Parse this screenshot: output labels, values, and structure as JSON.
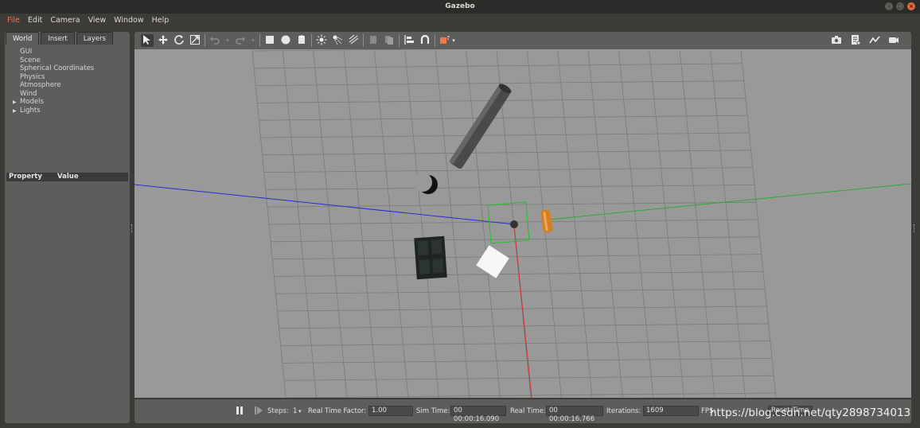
{
  "window": {
    "title": "Gazebo",
    "controls": [
      "–",
      "□",
      "×"
    ]
  },
  "menu": [
    {
      "label": "File",
      "active": true
    },
    {
      "label": "Edit"
    },
    {
      "label": "Camera"
    },
    {
      "label": "View"
    },
    {
      "label": "Window"
    },
    {
      "label": "Help"
    }
  ],
  "left_panel": {
    "tabs": [
      "World",
      "Insert",
      "Layers"
    ],
    "active_tab": "World",
    "tree": [
      {
        "label": "GUI",
        "expandable": false
      },
      {
        "label": "Scene",
        "expandable": false
      },
      {
        "label": "Spherical Coordinates",
        "expandable": false
      },
      {
        "label": "Physics",
        "expandable": false
      },
      {
        "label": "Atmosphere",
        "expandable": false
      },
      {
        "label": "Wind",
        "expandable": false
      },
      {
        "label": "Models",
        "expandable": true
      },
      {
        "label": "Lights",
        "expandable": true
      }
    ],
    "property_header": {
      "property": "Property",
      "value": "Value"
    }
  },
  "toolbar": {
    "icons": [
      "select-arrow-icon",
      "translate-icon",
      "rotate-icon",
      "scale-icon",
      "undo-icon",
      "redo-icon",
      "box-icon",
      "sphere-icon",
      "cylinder-icon",
      "point-light-icon",
      "spot-light-icon",
      "directional-light-icon",
      "copy-icon",
      "paste-icon",
      "align-icon",
      "snap-icon",
      "view-angle-icon"
    ],
    "right_icons": [
      "screenshot-icon",
      "log-icon",
      "plot-icon",
      "video-record-icon"
    ]
  },
  "bottom_bar": {
    "steps_label": "Steps:",
    "steps_value": "1",
    "rtf_label": "Real Time Factor:",
    "rtf_value": "1.00",
    "sim_time_label": "Sim Time:",
    "sim_time_value": "00 00:00:16.090",
    "real_time_label": "Real Time:",
    "real_time_value": "00 00:00:16.766",
    "iterations_label": "Iterations:",
    "iterations_value": "1609",
    "fps_label": "FPS:",
    "reset_label": "Reset Time"
  },
  "watermark": "https://blog.csdn.net/qty2898734013",
  "colors": {
    "accent": "#f07746",
    "viewport_bg": "#999999",
    "panel_bg": "#5d5d5b",
    "x_axis": "#d03030",
    "y_axis": "#2fa82f",
    "z_axis": "#2a2ad0"
  }
}
